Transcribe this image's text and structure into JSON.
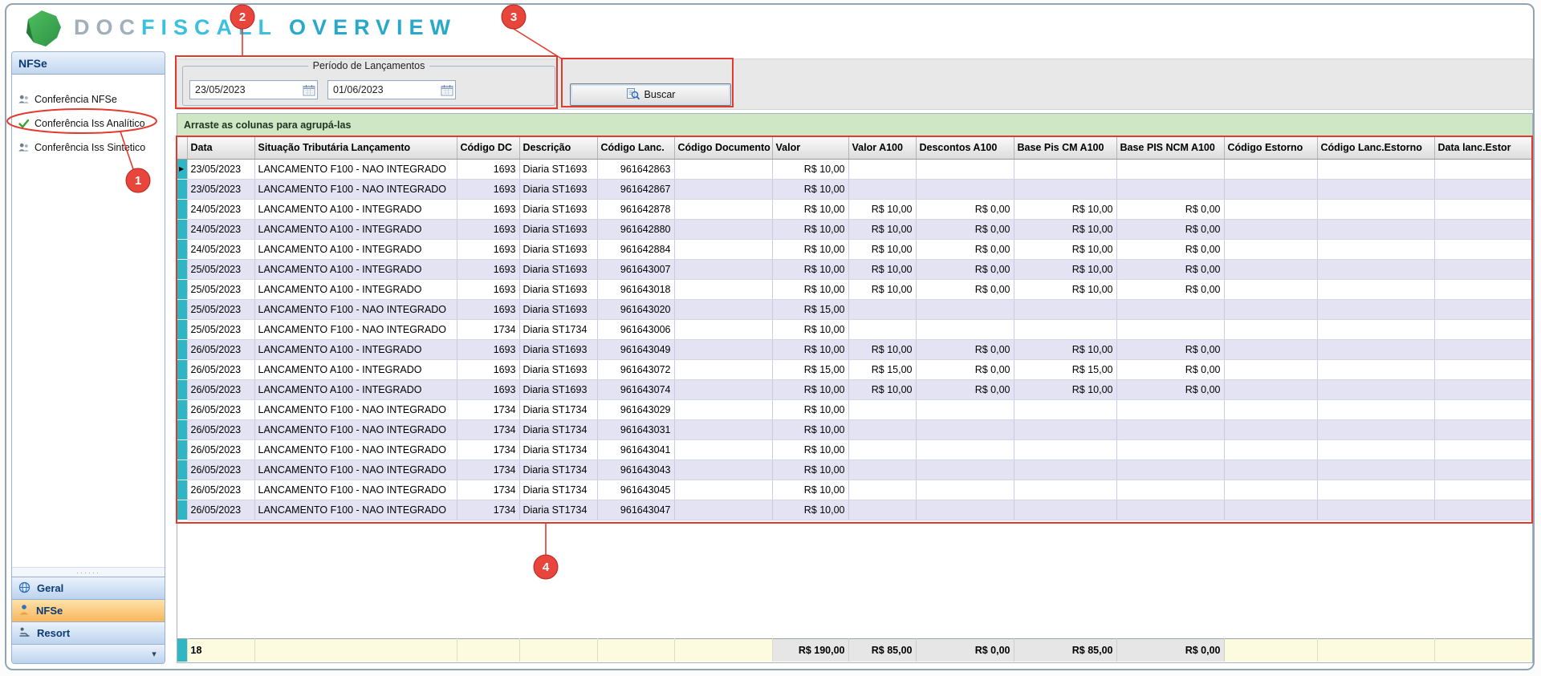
{
  "header": {
    "logo_doc": "DOC",
    "logo_fiscall": "FISCALL",
    "logo_overview": "OVERVIEW"
  },
  "sidebar": {
    "title": "NFSe",
    "items": [
      {
        "label": "Conferência NFSe"
      },
      {
        "label": "Conferência Iss Analítico"
      },
      {
        "label": "Conferência Iss Sintetico"
      }
    ],
    "nav": [
      {
        "label": "Geral"
      },
      {
        "label": "NFSe"
      },
      {
        "label": "Resort"
      }
    ]
  },
  "toolbar": {
    "period_label": "Período de Lançamentos",
    "date_from": "23/05/2023",
    "date_to": "01/06/2023",
    "buscar_label": "Buscar"
  },
  "grid": {
    "group_hint": "Arraste as colunas para agrupá-las",
    "columns": [
      "Data",
      "Situação Tributária Lançamento",
      "Código DC",
      "Descrição",
      "Código Lanc.",
      "Código Documento",
      "Valor",
      "Valor A100",
      "Descontos A100",
      "Base Pis CM A100",
      "Base PIS NCM A100",
      "Código Estorno",
      "Código Lanc.Estorno",
      "Data lanc.Estor"
    ],
    "rows": [
      [
        "23/05/2023",
        "LANCAMENTO F100 - NAO INTEGRADO",
        "1693",
        "Diaria ST1693",
        "961642863",
        "",
        "R$ 10,00",
        "",
        "",
        "",
        "",
        "",
        "",
        ""
      ],
      [
        "23/05/2023",
        "LANCAMENTO F100 - NAO INTEGRADO",
        "1693",
        "Diaria ST1693",
        "961642867",
        "",
        "R$ 10,00",
        "",
        "",
        "",
        "",
        "",
        "",
        ""
      ],
      [
        "24/05/2023",
        "LANCAMENTO A100 - INTEGRADO",
        "1693",
        "Diaria ST1693",
        "961642878",
        "",
        "R$ 10,00",
        "R$ 10,00",
        "R$ 0,00",
        "R$ 10,00",
        "R$ 0,00",
        "",
        "",
        ""
      ],
      [
        "24/05/2023",
        "LANCAMENTO A100 - INTEGRADO",
        "1693",
        "Diaria ST1693",
        "961642880",
        "",
        "R$ 10,00",
        "R$ 10,00",
        "R$ 0,00",
        "R$ 10,00",
        "R$ 0,00",
        "",
        "",
        ""
      ],
      [
        "24/05/2023",
        "LANCAMENTO A100 - INTEGRADO",
        "1693",
        "Diaria ST1693",
        "961642884",
        "",
        "R$ 10,00",
        "R$ 10,00",
        "R$ 0,00",
        "R$ 10,00",
        "R$ 0,00",
        "",
        "",
        ""
      ],
      [
        "25/05/2023",
        "LANCAMENTO A100 - INTEGRADO",
        "1693",
        "Diaria ST1693",
        "961643007",
        "",
        "R$ 10,00",
        "R$ 10,00",
        "R$ 0,00",
        "R$ 10,00",
        "R$ 0,00",
        "",
        "",
        ""
      ],
      [
        "25/05/2023",
        "LANCAMENTO A100 - INTEGRADO",
        "1693",
        "Diaria ST1693",
        "961643018",
        "",
        "R$ 10,00",
        "R$ 10,00",
        "R$ 0,00",
        "R$ 10,00",
        "R$ 0,00",
        "",
        "",
        ""
      ],
      [
        "25/05/2023",
        "LANCAMENTO F100 - NAO INTEGRADO",
        "1693",
        "Diaria ST1693",
        "961643020",
        "",
        "R$ 15,00",
        "",
        "",
        "",
        "",
        "",
        "",
        ""
      ],
      [
        "25/05/2023",
        "LANCAMENTO F100 - NAO INTEGRADO",
        "1734",
        "Diaria ST1734",
        "961643006",
        "",
        "R$ 10,00",
        "",
        "",
        "",
        "",
        "",
        "",
        ""
      ],
      [
        "26/05/2023",
        "LANCAMENTO A100 - INTEGRADO",
        "1693",
        "Diaria ST1693",
        "961643049",
        "",
        "R$ 10,00",
        "R$ 10,00",
        "R$ 0,00",
        "R$ 10,00",
        "R$ 0,00",
        "",
        "",
        ""
      ],
      [
        "26/05/2023",
        "LANCAMENTO A100 - INTEGRADO",
        "1693",
        "Diaria ST1693",
        "961643072",
        "",
        "R$ 15,00",
        "R$ 15,00",
        "R$ 0,00",
        "R$ 15,00",
        "R$ 0,00",
        "",
        "",
        ""
      ],
      [
        "26/05/2023",
        "LANCAMENTO A100 - INTEGRADO",
        "1693",
        "Diaria ST1693",
        "961643074",
        "",
        "R$ 10,00",
        "R$ 10,00",
        "R$ 0,00",
        "R$ 10,00",
        "R$ 0,00",
        "",
        "",
        ""
      ],
      [
        "26/05/2023",
        "LANCAMENTO F100 - NAO INTEGRADO",
        "1734",
        "Diaria ST1734",
        "961643029",
        "",
        "R$ 10,00",
        "",
        "",
        "",
        "",
        "",
        "",
        ""
      ],
      [
        "26/05/2023",
        "LANCAMENTO F100 - NAO INTEGRADO",
        "1734",
        "Diaria ST1734",
        "961643031",
        "",
        "R$ 10,00",
        "",
        "",
        "",
        "",
        "",
        "",
        ""
      ],
      [
        "26/05/2023",
        "LANCAMENTO F100 - NAO INTEGRADO",
        "1734",
        "Diaria ST1734",
        "961643041",
        "",
        "R$ 10,00",
        "",
        "",
        "",
        "",
        "",
        "",
        ""
      ],
      [
        "26/05/2023",
        "LANCAMENTO F100 - NAO INTEGRADO",
        "1734",
        "Diaria ST1734",
        "961643043",
        "",
        "R$ 10,00",
        "",
        "",
        "",
        "",
        "",
        "",
        ""
      ],
      [
        "26/05/2023",
        "LANCAMENTO F100 - NAO INTEGRADO",
        "1734",
        "Diaria ST1734",
        "961643045",
        "",
        "R$ 10,00",
        "",
        "",
        "",
        "",
        "",
        "",
        ""
      ],
      [
        "26/05/2023",
        "LANCAMENTO F100 - NAO INTEGRADO",
        "1734",
        "Diaria ST1734",
        "961643047",
        "",
        "R$ 10,00",
        "",
        "",
        "",
        "",
        "",
        "",
        ""
      ]
    ],
    "footer": {
      "count": "18",
      "valor": "R$ 190,00",
      "valor_a100": "R$ 85,00",
      "descontos_a100": "R$ 0,00",
      "base_pis_cm_a100": "R$ 85,00",
      "base_pis_ncm_a100": "R$ 0,00"
    }
  },
  "annotations": {
    "labels": [
      "1",
      "2",
      "3",
      "4"
    ]
  },
  "icons": {
    "current_row_arrow": "▶",
    "overflow_arrow": "▾",
    "splitter_dots": "······"
  },
  "colors": {
    "annotation_red": "#e23b2e",
    "teal_marker": "#2fb6c4",
    "selected_nav_orange": "#f7b75d"
  }
}
